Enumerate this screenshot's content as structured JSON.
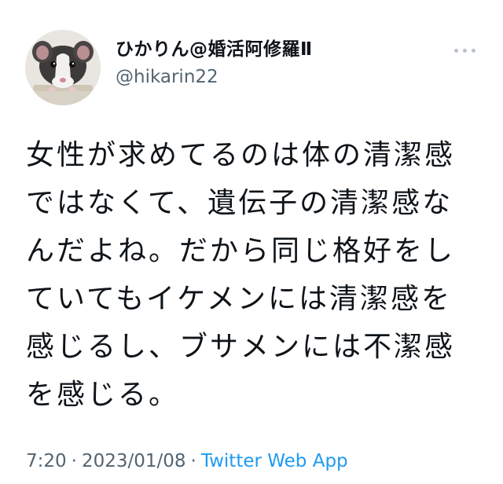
{
  "author": {
    "display_name": "ひかりん@婚活阿修羅Ⅱ",
    "handle": "@hikarin22",
    "avatar_icon": "rat-avatar-icon"
  },
  "menu": {
    "more_icon": "more-options-icon"
  },
  "tweet": {
    "text": "女性が求めてるのは体の清潔感\nではなくて、遺伝子の清潔感な\nんだよね。だから同じ格好をし\nていてもイケメンには清潔感を\n感じるし、ブサメンには不潔感\nを感じる。"
  },
  "meta": {
    "time": "7:20",
    "separator": "·",
    "date": "2023/01/08",
    "source": "Twitter Web App"
  },
  "colors": {
    "text": "#0f1419",
    "secondary": "#536471",
    "link": "#1d9bf0",
    "more_dots": "#b9c2cb"
  }
}
